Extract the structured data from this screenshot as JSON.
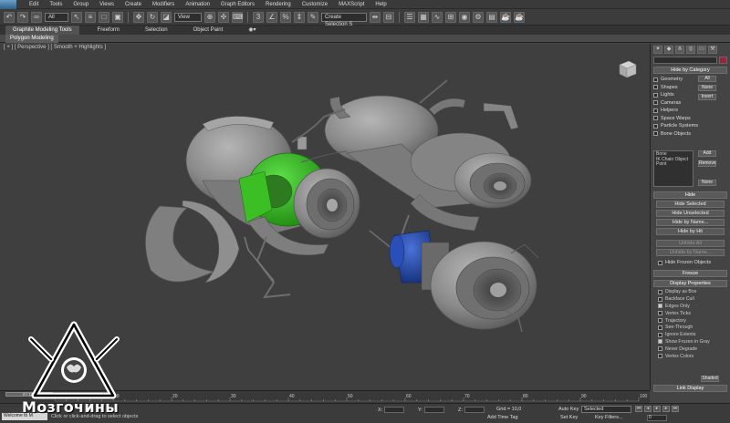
{
  "menubar": {
    "items": [
      "Edit",
      "Tools",
      "Group",
      "Views",
      "Create",
      "Modifiers",
      "Animation",
      "Graph Editors",
      "Rendering",
      "Customize",
      "MAXScript",
      "Help"
    ]
  },
  "toolbar": {
    "selection_filter": "All",
    "reference_coord": "View",
    "named_selection_placeholder": "Create Selection S"
  },
  "ribbon": {
    "tabs": [
      "Graphite Modeling Tools",
      "Freeform",
      "Selection",
      "Object Paint"
    ],
    "active_tab": "Graphite Modeling Tools",
    "sub_tab": "Polygon Modeling"
  },
  "viewport": {
    "label": "[ + ] [ Perspective ] [ Smooth + Highlights ]"
  },
  "command_panel": {
    "hide_by_category": {
      "title": "Hide by Category",
      "categories": [
        {
          "label": "Geometry",
          "checked": false
        },
        {
          "label": "Shapes",
          "checked": false
        },
        {
          "label": "Lights",
          "checked": false
        },
        {
          "label": "Cameras",
          "checked": false
        },
        {
          "label": "Helpers",
          "checked": false
        },
        {
          "label": "Space Warps",
          "checked": false
        },
        {
          "label": "Particle Systems",
          "checked": false
        },
        {
          "label": "Bone Objects",
          "checked": false
        }
      ],
      "btn_all": "All",
      "btn_none": "None",
      "btn_invert": "Invert",
      "list_items": [
        "Bone",
        "IK Chain Object",
        "Point"
      ],
      "btn_add": "Add",
      "btn_remove": "Remove",
      "btn_none2": "None"
    },
    "hide": {
      "title": "Hide",
      "buttons": [
        "Hide Selected",
        "Hide Unselected",
        "Hide by Name...",
        "Hide by Hit"
      ],
      "disabled_buttons": [
        "Unhide All",
        "Unhide by Name..."
      ],
      "hide_frozen": "Hide Frozen Objects"
    },
    "freeze": {
      "title": "Freeze"
    },
    "display_properties": {
      "title": "Display Properties",
      "options": [
        {
          "label": "Display as Box",
          "checked": false
        },
        {
          "label": "Backface Cull",
          "checked": false
        },
        {
          "label": "Edges Only",
          "checked": true
        },
        {
          "label": "Vertex Ticks",
          "checked": false
        },
        {
          "label": "Trajectory",
          "checked": false
        },
        {
          "label": "See-Through",
          "checked": false
        },
        {
          "label": "Ignore Extents",
          "checked": false
        },
        {
          "label": "Show Frozen in Gray",
          "checked": true
        },
        {
          "label": "Never Degrade",
          "checked": false
        },
        {
          "label": "Vertex Colors",
          "checked": false
        }
      ],
      "shaded_btn": "Shaded"
    },
    "link_display": {
      "title": "Link Display"
    }
  },
  "timeline": {
    "slider_label": "0 / 100",
    "ticks": [
      "0",
      "10",
      "20",
      "30",
      "40",
      "50",
      "60",
      "70",
      "80",
      "90",
      "100"
    ]
  },
  "status": {
    "listener_text": "Welcome to M",
    "message": "Click or click-and-drag to select objects",
    "x_label": "X:",
    "y_label": "Y:",
    "z_label": "Z:",
    "grid": "Grid = 10,0",
    "add_time_tag": "Add Time Tag",
    "auto_key": "Auto Key",
    "set_key": "Set Key",
    "selected": "Selected",
    "key_filters": "Key Filters...",
    "frame": "0"
  },
  "watermark": {
    "text": "Мозгочины"
  },
  "colors": {
    "accent_green": "#33c21a",
    "accent_blue": "#1f45a8",
    "object_swatch": "#a0223a",
    "model_gray": "#8a8a8a"
  }
}
